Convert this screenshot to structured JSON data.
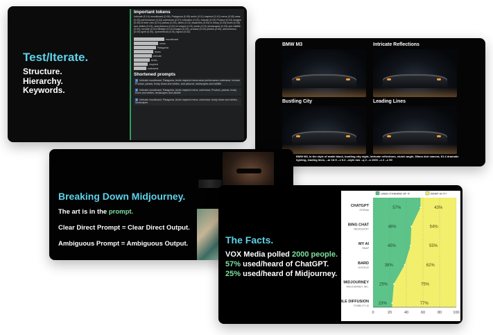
{
  "slide1": {
    "title": "Test/Iterate.",
    "subtitle_lines": [
      "Structure.",
      "Hierarchy.",
      "Keywords."
    ],
    "panel": {
      "heading": "Important tokens",
      "tokens_text": "intricate (0.14) moodboard (0.06), Patagonia (0.05) arctic (0.11) inspired (0.10) mens (0.05) wear (0.03) performance (0.04) outerwear (0.07) collection (0.02), include (0.03) Product (0.04) images (0.05) of their new (0.01) parkas (0.03), fabric (0.01) swatches (0.03) in frosty (0.03) blues (0.05) and whites (0.03), and pictures (0.02) of unique (0.01) arctic (0.01) landscapes (0.03) and wildlife (0.04), include (0.01) lifestyle (0.01) images (0.02), product (0.03) photos (0.00), adventurous (0.00) spirit (0.00), symmetrical (0.01) layout (0.02)",
      "bars": [
        {
          "label": "moodboard",
          "value": 1.0
        },
        {
          "label": "mens",
          "value": 0.8
        },
        {
          "label": "Patagonia",
          "value": 0.72
        },
        {
          "label": "blues",
          "value": 0.64
        },
        {
          "label": "intricate",
          "value": 0.58
        },
        {
          "label": "Arctic",
          "value": 0.52
        },
        {
          "label": "inspired",
          "value": 0.46
        },
        {
          "label": "outerwear",
          "value": 0.4
        }
      ],
      "shortened_heading": "Shortened prompts",
      "prompts": [
        {
          "num": "1",
          "text": "intricate moodboard, Patagonia, Arctic-inspired mens-wear performance outerwear. Include Product, parkas, frosty blues and whites, and pictures, landscapes and wildlife"
        },
        {
          "num": "2",
          "text": "intricate moodboard, Patagonia, Arctic-inspired mens, outerwear, Product, parkas, frosty blues and whites, landscapes and wildlife"
        },
        {
          "num": "3",
          "text": "intricate moodboard, Patagonia, Arctic-inspired mens, outerwear, frosty blues and whites, landscapes"
        }
      ]
    }
  },
  "slide2": {
    "images": [
      {
        "label": "BMW M3"
      },
      {
        "label": "Intricate Reflections"
      },
      {
        "label": "Bustling City"
      },
      {
        "label": "Leading Lines"
      }
    ],
    "caption": "BMW M3, in the style of matte black, bustling city night, intricate reflections, clutch angle, 35mm dslr camera, f/1.4 dramatic lighting, leading lines, --ar 16:9 --v 5.2 --style raw --q 2 --s 1000 --c 2 --c 50"
  },
  "slide3": {
    "title": "Breaking Down Midjourney.",
    "line1_prefix": "The art is in the ",
    "line1_highlight": "prompt.",
    "line2": "Clear Direct Prompt = Clear Direct Output.",
    "line3": "Ambiguous Prompt = Ambiguous Output."
  },
  "slide4": {
    "title": "The Facts.",
    "line1_prefix": "VOX Media polled ",
    "line1_highlight": "2000 people.",
    "line2_highlight": "57%",
    "line2_suffix": " used/heard of ChatGPT.",
    "line3_highlight": "25%",
    "line3_suffix": " used/heard of Midjourney."
  },
  "chart_data": {
    "type": "area",
    "legend": [
      "USED IT/HEARD OF IT",
      "WHAT IS IT?"
    ],
    "legend_placement": "top",
    "colors": {
      "used": "#5cc389",
      "what": "#f1ef6c"
    },
    "categories": [
      {
        "name": "CHATGPT",
        "sub": "OPENAI"
      },
      {
        "name": "BING CHAT",
        "sub": "MICROSOFT"
      },
      {
        "name": "MY AI",
        "sub": "SNAP"
      },
      {
        "name": "BARD",
        "sub": "GOOGLE"
      },
      {
        "name": "MIDJOURNEY",
        "sub": "MIDJOURNEY, INC."
      },
      {
        "name": "STABLE DIFFUSION",
        "sub": "STABILITY AI"
      }
    ],
    "series": [
      {
        "name": "USED IT/HEARD OF IT",
        "values": [
          57,
          46,
          45,
          38,
          25,
          23
        ]
      },
      {
        "name": "WHAT IS IT?",
        "values": [
          43,
          54,
          55,
          62,
          75,
          77
        ]
      }
    ],
    "x_ticks": [
      0,
      20,
      40,
      60,
      80,
      100
    ],
    "xlim": [
      0,
      100
    ],
    "grid": true
  }
}
